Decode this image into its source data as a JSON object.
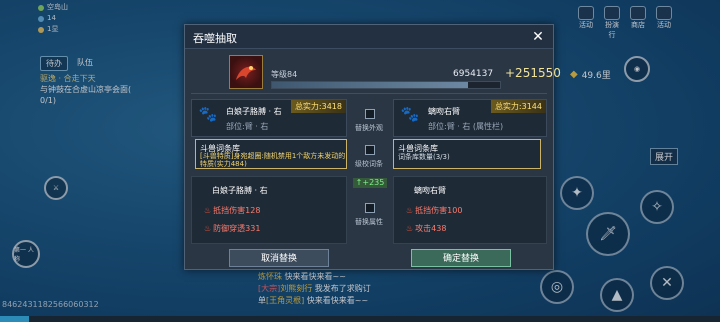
{
  "hud": {
    "status_lines": [
      "空岛山",
      "14",
      "1显"
    ],
    "tabs": [
      "待办",
      "队伍"
    ],
    "quest_title": "驱逸 · 合走下天",
    "quest_desc": "与钟鼓在合虚山凉亭会面(",
    "quest_progress": "0/1)",
    "top_icons": [
      "活动",
      "扮演行",
      "商店",
      "活动"
    ],
    "currency_value": "49.6里",
    "first_person_label": "第一\n人称",
    "expand_label": "展开",
    "id_text": "8462431182566060312"
  },
  "chat": {
    "line1_tag": "炼怀珠",
    "line1_text": "快来看快来看~~",
    "line2_tag": "[大宗]",
    "line2_name": "刘熊刻行",
    "line2_text": "我发布了求购订",
    "line3_prefix": "单",
    "line3_link": "[王角灵根]",
    "line3_text": "快来看快来看~~"
  },
  "modal": {
    "title": "吞噬抽取",
    "level_label": "等级84",
    "total_power": "6954137",
    "power_gain": "+251550",
    "left_item": {
      "name": "白娘子胳膊 · 右",
      "part": "部位:臂 · 右",
      "power": "总实力:3418"
    },
    "right_item": {
      "name": "螭吻右臂",
      "part": "部位:臂 · 右 (属性栏)",
      "power": "总实力:3144"
    },
    "swap_appearance": "替换外观",
    "level_check": "级校词条",
    "swap_attr": "替换属性",
    "left_affix": {
      "title": "斗兽词条库",
      "desc": "[斗兽特质]身宛超圈:随机禁用1个敌方未发动的特质(实力484)"
    },
    "right_affix": {
      "title": "斗兽词条库",
      "desc": "词条库数量(3/3)"
    },
    "stat_gain": "↑+235",
    "left_stats": {
      "header": "白娘子胳膊 · 右",
      "items": [
        "抵挡伤害128",
        "防御穿透331"
      ]
    },
    "right_stats": {
      "header": "螭吻右臂",
      "items": [
        "抵挡伤害100",
        "攻击438"
      ]
    },
    "cancel_label": "取消替换",
    "confirm_label": "确定替换"
  },
  "colors": {
    "accent_gold": "#ffe27a",
    "affix_highlight": "#f1d36b",
    "stat_red": "#ff7a6a",
    "confirm_green": "#3b6a5a"
  }
}
